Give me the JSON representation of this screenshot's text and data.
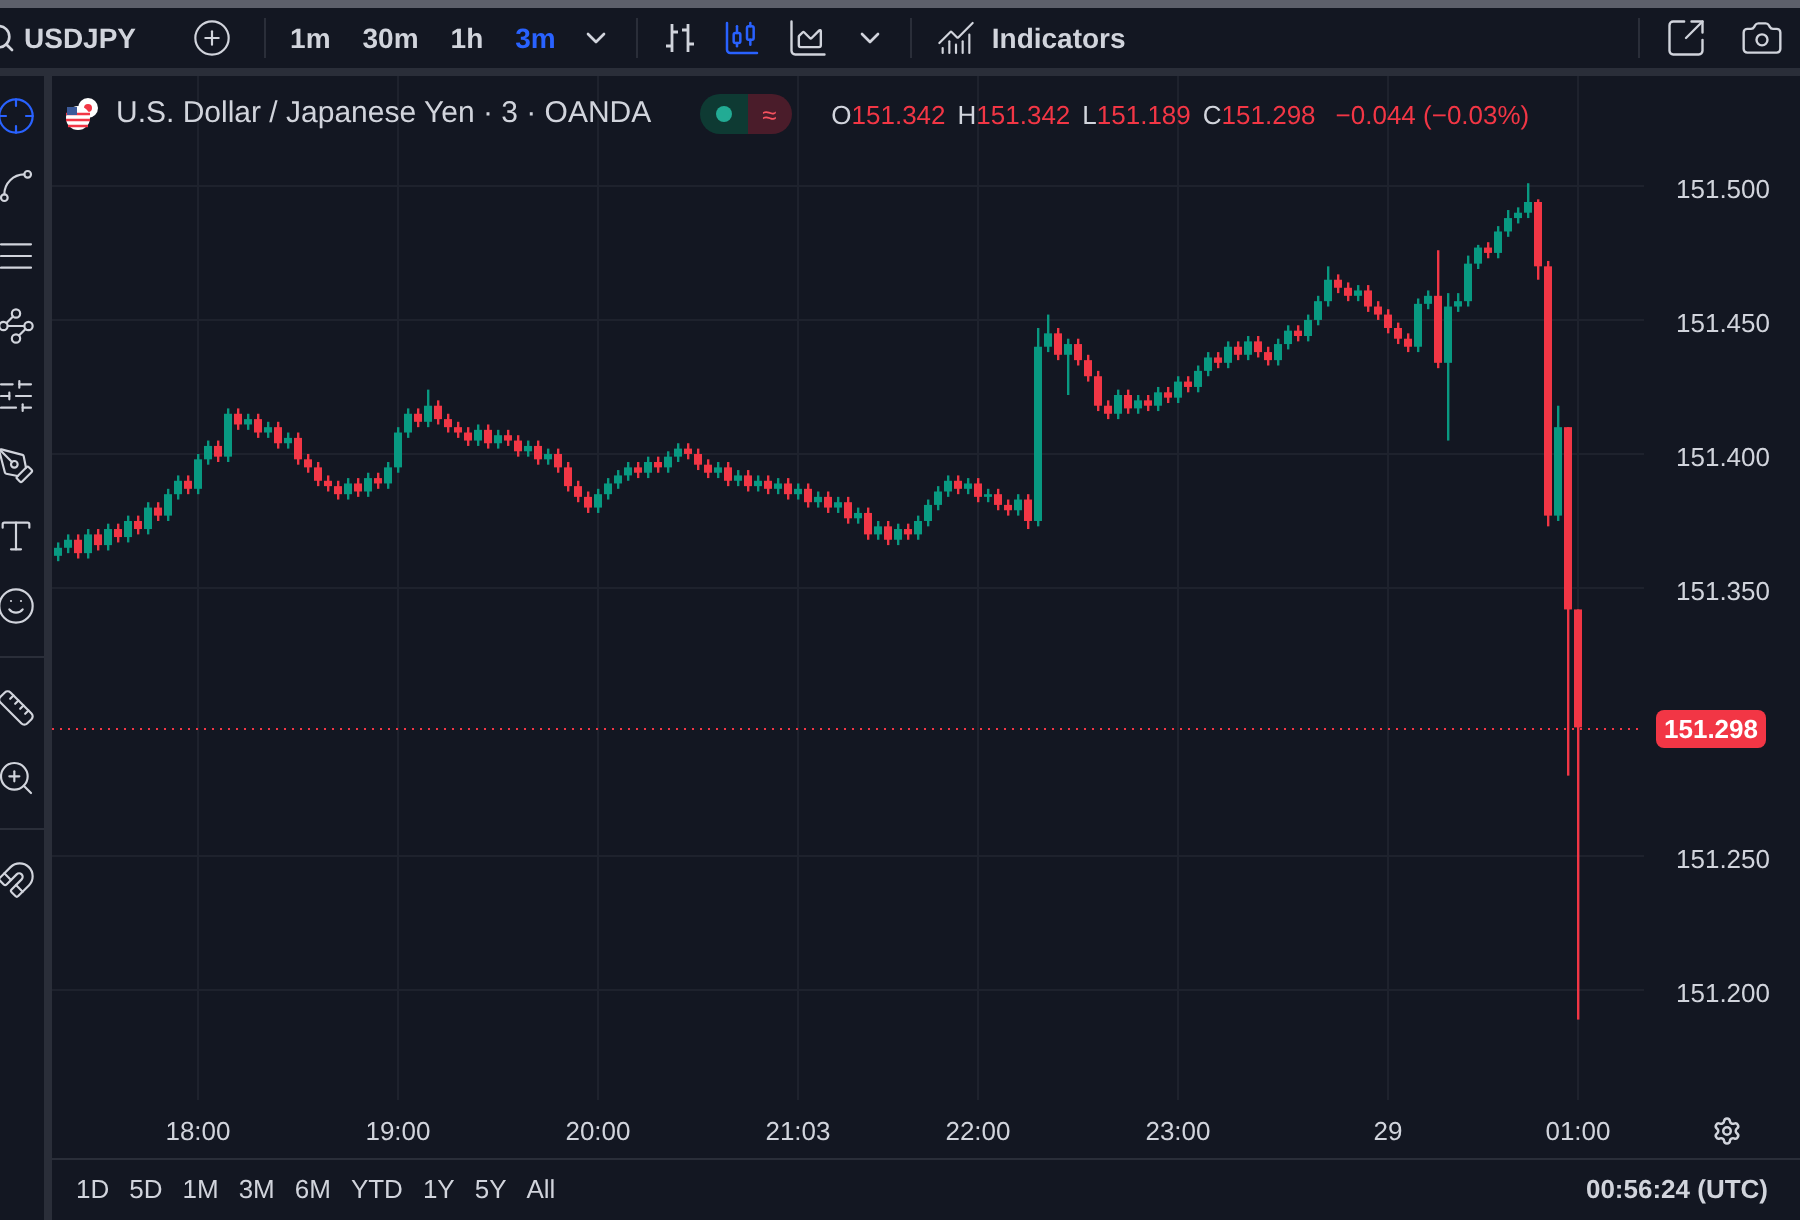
{
  "toolbar": {
    "symbol": "USDJPY",
    "intervals": [
      {
        "label": "1m",
        "selected": false
      },
      {
        "label": "30m",
        "selected": false
      },
      {
        "label": "1h",
        "selected": false
      },
      {
        "label": "3m",
        "selected": true
      }
    ],
    "indicators": "Indicators"
  },
  "legend": {
    "title": "U.S. Dollar / Japanese Yen · 3 · OANDA",
    "status_symbol": "≈",
    "ohlc": [
      {
        "label": "O",
        "value": "151.342"
      },
      {
        "label": "H",
        "value": "151.342"
      },
      {
        "label": "L",
        "value": "151.189"
      },
      {
        "label": "C",
        "value": "151.298"
      }
    ],
    "change": "−0.044 (−0.03%)"
  },
  "chart": {
    "current_price": "151.298",
    "chart_data": {
      "type": "candlestick",
      "categories": [
        null,
        null,
        null,
        null,
        null,
        null,
        null,
        null,
        null,
        null,
        null,
        null,
        null,
        null,
        "18:00",
        null,
        null,
        null,
        null,
        null,
        null,
        null,
        null,
        null,
        null,
        null,
        null,
        null,
        null,
        null,
        null,
        null,
        null,
        null,
        "19:00",
        null,
        null,
        null,
        null,
        null,
        null,
        null,
        null,
        null,
        null,
        null,
        null,
        null,
        null,
        null,
        null,
        null,
        null,
        null,
        "20:00",
        null,
        null,
        null,
        null,
        null,
        null,
        null,
        null,
        null,
        null,
        null,
        null,
        null,
        null,
        null,
        null,
        null,
        null,
        null,
        "21:03",
        null,
        null,
        null,
        null,
        null,
        null,
        null,
        null,
        null,
        null,
        null,
        null,
        null,
        null,
        null,
        null,
        null,
        "22:00",
        null,
        null,
        null,
        null,
        null,
        null,
        null,
        null,
        null,
        null,
        null,
        null,
        null,
        null,
        null,
        null,
        null,
        null,
        null,
        "23:00",
        null,
        null,
        null,
        null,
        null,
        null,
        null,
        null,
        null,
        null,
        null,
        null,
        null,
        null,
        null,
        null,
        null,
        null,
        null,
        null,
        "29",
        null,
        null,
        null,
        null,
        null,
        null,
        null,
        null,
        null,
        null,
        null,
        null,
        null,
        null,
        null,
        null,
        null,
        null,
        "01:00"
      ],
      "ohlc": [
        [
          151.362,
          151.367,
          151.36,
          151.365
        ],
        [
          151.365,
          151.37,
          151.363,
          151.368
        ],
        [
          151.368,
          151.37,
          151.361,
          151.363
        ],
        [
          151.363,
          151.372,
          151.361,
          151.37
        ],
        [
          151.37,
          151.372,
          151.364,
          151.366
        ],
        [
          151.366,
          151.374,
          151.364,
          151.372
        ],
        [
          151.372,
          151.374,
          151.367,
          151.369
        ],
        [
          151.369,
          151.377,
          151.367,
          151.375
        ],
        [
          151.375,
          151.377,
          151.37,
          151.372
        ],
        [
          151.372,
          151.382,
          151.37,
          151.38
        ],
        [
          151.38,
          151.382,
          151.375,
          151.377
        ],
        [
          151.377,
          151.387,
          151.375,
          151.385
        ],
        [
          151.385,
          151.392,
          151.383,
          151.39
        ],
        [
          151.39,
          151.392,
          151.385,
          151.387
        ],
        [
          151.387,
          151.4,
          151.385,
          151.398
        ],
        [
          151.398,
          151.405,
          151.396,
          151.403
        ],
        [
          151.403,
          151.405,
          151.397,
          151.399
        ],
        [
          151.399,
          151.417,
          151.397,
          151.415
        ],
        [
          151.415,
          151.417,
          151.409,
          151.411
        ],
        [
          151.411,
          151.415,
          151.409,
          151.413
        ],
        [
          151.413,
          151.415,
          151.406,
          151.408
        ],
        [
          151.408,
          151.412,
          151.406,
          151.41
        ],
        [
          151.41,
          151.412,
          151.402,
          151.404
        ],
        [
          151.404,
          151.408,
          151.402,
          151.406
        ],
        [
          151.406,
          151.408,
          151.396,
          151.398
        ],
        [
          151.398,
          151.4,
          151.393,
          151.395
        ],
        [
          151.395,
          151.397,
          151.388,
          151.39
        ],
        [
          151.39,
          151.392,
          151.386,
          151.388
        ],
        [
          151.388,
          151.39,
          151.383,
          151.385
        ],
        [
          151.385,
          151.391,
          151.383,
          151.389
        ],
        [
          151.389,
          151.391,
          151.384,
          151.386
        ],
        [
          151.386,
          151.393,
          151.384,
          151.391
        ],
        [
          151.391,
          151.393,
          151.387,
          151.389
        ],
        [
          151.389,
          151.397,
          151.387,
          151.395
        ],
        [
          151.395,
          151.41,
          151.393,
          151.408
        ],
        [
          151.408,
          151.417,
          151.406,
          151.415
        ],
        [
          151.415,
          151.417,
          151.41,
          151.412
        ],
        [
          151.412,
          151.424,
          151.41,
          151.418
        ],
        [
          151.418,
          151.42,
          151.411,
          151.413
        ],
        [
          151.413,
          151.415,
          151.408,
          151.41
        ],
        [
          151.41,
          151.412,
          151.406,
          151.408
        ],
        [
          151.408,
          151.41,
          151.403,
          151.405
        ],
        [
          151.405,
          151.411,
          151.403,
          151.409
        ],
        [
          151.409,
          151.411,
          151.402,
          151.404
        ],
        [
          151.404,
          151.409,
          151.402,
          151.407
        ],
        [
          151.407,
          151.409,
          151.403,
          151.405
        ],
        [
          151.405,
          151.407,
          151.399,
          151.401
        ],
        [
          151.401,
          151.405,
          151.399,
          151.403
        ],
        [
          151.403,
          151.405,
          151.396,
          151.398
        ],
        [
          151.398,
          151.402,
          151.396,
          151.4
        ],
        [
          151.4,
          151.402,
          151.393,
          151.395
        ],
        [
          151.395,
          151.397,
          151.386,
          151.388
        ],
        [
          151.388,
          151.39,
          151.382,
          151.384
        ],
        [
          151.384,
          151.386,
          151.378,
          151.38
        ],
        [
          151.38,
          151.387,
          151.378,
          151.385
        ],
        [
          151.385,
          151.391,
          151.383,
          151.389
        ],
        [
          151.389,
          151.394,
          151.387,
          151.392
        ],
        [
          151.392,
          151.397,
          151.39,
          151.395
        ],
        [
          151.395,
          151.397,
          151.391,
          151.393
        ],
        [
          151.393,
          151.399,
          151.391,
          151.397
        ],
        [
          151.397,
          151.399,
          151.393,
          151.395
        ],
        [
          151.395,
          151.401,
          151.393,
          151.399
        ],
        [
          151.399,
          151.404,
          151.397,
          151.402
        ],
        [
          151.402,
          151.404,
          151.398,
          151.4
        ],
        [
          151.4,
          151.402,
          151.394,
          151.396
        ],
        [
          151.396,
          151.398,
          151.391,
          151.393
        ],
        [
          151.393,
          151.397,
          151.391,
          151.395
        ],
        [
          151.395,
          151.397,
          151.388,
          151.39
        ],
        [
          151.39,
          151.394,
          151.388,
          151.392
        ],
        [
          151.392,
          151.394,
          151.386,
          151.388
        ],
        [
          151.388,
          151.392,
          151.386,
          151.39
        ],
        [
          151.39,
          151.392,
          151.385,
          151.387
        ],
        [
          151.387,
          151.391,
          151.385,
          151.389
        ],
        [
          151.389,
          151.391,
          151.383,
          151.385
        ],
        [
          151.385,
          151.389,
          151.383,
          151.387
        ],
        [
          151.387,
          151.389,
          151.38,
          151.382
        ],
        [
          151.382,
          151.386,
          151.38,
          151.384
        ],
        [
          151.384,
          151.386,
          151.378,
          151.38
        ],
        [
          151.38,
          151.384,
          151.378,
          151.382
        ],
        [
          151.382,
          151.384,
          151.374,
          151.376
        ],
        [
          151.376,
          151.38,
          151.374,
          151.378
        ],
        [
          151.378,
          151.38,
          151.368,
          151.37
        ],
        [
          151.37,
          151.375,
          151.368,
          151.373
        ],
        [
          151.373,
          151.375,
          151.366,
          151.368
        ],
        [
          151.368,
          151.374,
          151.366,
          151.372
        ],
        [
          151.372,
          151.374,
          151.368,
          151.37
        ],
        [
          151.37,
          151.377,
          151.368,
          151.375
        ],
        [
          151.375,
          151.383,
          151.373,
          151.381
        ],
        [
          151.381,
          151.388,
          151.379,
          151.386
        ],
        [
          151.386,
          151.392,
          151.384,
          151.39
        ],
        [
          151.39,
          151.392,
          151.385,
          151.387
        ],
        [
          151.387,
          151.391,
          151.385,
          151.389
        ],
        [
          151.389,
          151.391,
          151.382,
          151.384
        ],
        [
          151.384,
          151.387,
          151.382,
          151.385
        ],
        [
          151.385,
          151.387,
          151.379,
          151.381
        ],
        [
          151.381,
          151.383,
          151.377,
          151.379
        ],
        [
          151.379,
          151.385,
          151.377,
          151.383
        ],
        [
          151.383,
          151.385,
          151.372,
          151.375
        ],
        [
          151.375,
          151.447,
          151.373,
          151.44
        ],
        [
          151.44,
          151.452,
          151.438,
          151.445
        ],
        [
          151.445,
          151.447,
          151.435,
          151.437
        ],
        [
          151.437,
          151.443,
          151.422,
          151.441
        ],
        [
          151.441,
          151.443,
          151.433,
          151.435
        ],
        [
          151.435,
          151.437,
          151.427,
          151.429
        ],
        [
          151.429,
          151.431,
          151.416,
          151.418
        ],
        [
          151.418,
          151.42,
          151.413,
          151.415
        ],
        [
          151.415,
          151.424,
          151.413,
          151.422
        ],
        [
          151.422,
          151.424,
          151.415,
          151.417
        ],
        [
          151.417,
          151.422,
          151.415,
          151.42
        ],
        [
          151.42,
          151.422,
          151.416,
          151.418
        ],
        [
          151.418,
          151.425,
          151.416,
          151.423
        ],
        [
          151.423,
          151.425,
          151.419,
          151.421
        ],
        [
          151.421,
          151.429,
          151.419,
          151.427
        ],
        [
          151.427,
          151.429,
          151.423,
          151.425
        ],
        [
          151.425,
          151.433,
          151.423,
          151.431
        ],
        [
          151.431,
          151.438,
          151.429,
          151.436
        ],
        [
          151.436,
          151.438,
          151.432,
          151.434
        ],
        [
          151.434,
          151.442,
          151.432,
          151.44
        ],
        [
          151.44,
          151.442,
          151.435,
          151.437
        ],
        [
          151.437,
          151.444,
          151.435,
          151.442
        ],
        [
          151.442,
          151.444,
          151.436,
          151.438
        ],
        [
          151.438,
          151.44,
          151.433,
          151.435
        ],
        [
          151.435,
          151.443,
          151.433,
          151.441
        ],
        [
          151.441,
          151.448,
          151.439,
          151.446
        ],
        [
          151.446,
          151.448,
          151.442,
          151.444
        ],
        [
          151.444,
          151.452,
          151.442,
          151.45
        ],
        [
          151.45,
          151.459,
          151.448,
          151.457
        ],
        [
          151.457,
          151.47,
          151.455,
          151.465
        ],
        [
          151.465,
          151.467,
          151.46,
          151.462
        ],
        [
          151.462,
          151.464,
          151.457,
          151.459
        ],
        [
          151.459,
          151.463,
          151.457,
          151.461
        ],
        [
          151.461,
          151.463,
          151.453,
          151.455
        ],
        [
          151.455,
          151.457,
          151.45,
          151.452
        ],
        [
          151.452,
          151.454,
          151.445,
          151.447
        ],
        [
          151.447,
          151.449,
          151.441,
          151.443
        ],
        [
          151.443,
          151.445,
          151.438,
          151.44
        ],
        [
          151.44,
          151.458,
          151.438,
          151.456
        ],
        [
          151.456,
          151.461,
          151.454,
          151.459
        ],
        [
          151.459,
          151.476,
          151.432,
          151.434
        ],
        [
          151.434,
          151.46,
          151.405,
          151.455
        ],
        [
          151.455,
          151.46,
          151.453,
          151.457
        ],
        [
          151.457,
          151.474,
          151.455,
          151.471
        ],
        [
          151.471,
          151.478,
          151.469,
          151.477
        ],
        [
          151.477,
          151.479,
          151.473,
          151.475
        ],
        [
          151.475,
          151.485,
          151.473,
          151.483
        ],
        [
          151.483,
          151.491,
          151.481,
          151.488
        ],
        [
          151.488,
          151.492,
          151.486,
          151.49
        ],
        [
          151.49,
          151.501,
          151.488,
          151.494
        ],
        [
          151.494,
          151.495,
          151.465,
          151.47
        ],
        [
          151.47,
          151.472,
          151.373,
          151.377
        ],
        [
          151.377,
          151.418,
          151.375,
          151.41
        ],
        [
          151.41,
          151.41,
          151.28,
          151.342
        ],
        [
          151.342,
          151.342,
          151.189,
          151.298
        ]
      ],
      "yticks": [
        {
          "value": 151.5,
          "label": "151.500"
        },
        {
          "value": 151.45,
          "label": "151.450"
        },
        {
          "value": 151.4,
          "label": "151.400"
        },
        {
          "value": 151.35,
          "label": "151.350"
        },
        {
          "value": 151.25,
          "label": "151.250"
        },
        {
          "value": 151.2,
          "label": "151.200"
        }
      ],
      "ylim": [
        151.159,
        151.541
      ],
      "grid": true,
      "ref_lines": [
        {
          "axis": "y",
          "value": 151.298
        }
      ]
    }
  },
  "ranges": [
    "1D",
    "5D",
    "1M",
    "3M",
    "6M",
    "YTD",
    "1Y",
    "5Y",
    "All"
  ],
  "clock": "00:56:24 (UTC)"
}
